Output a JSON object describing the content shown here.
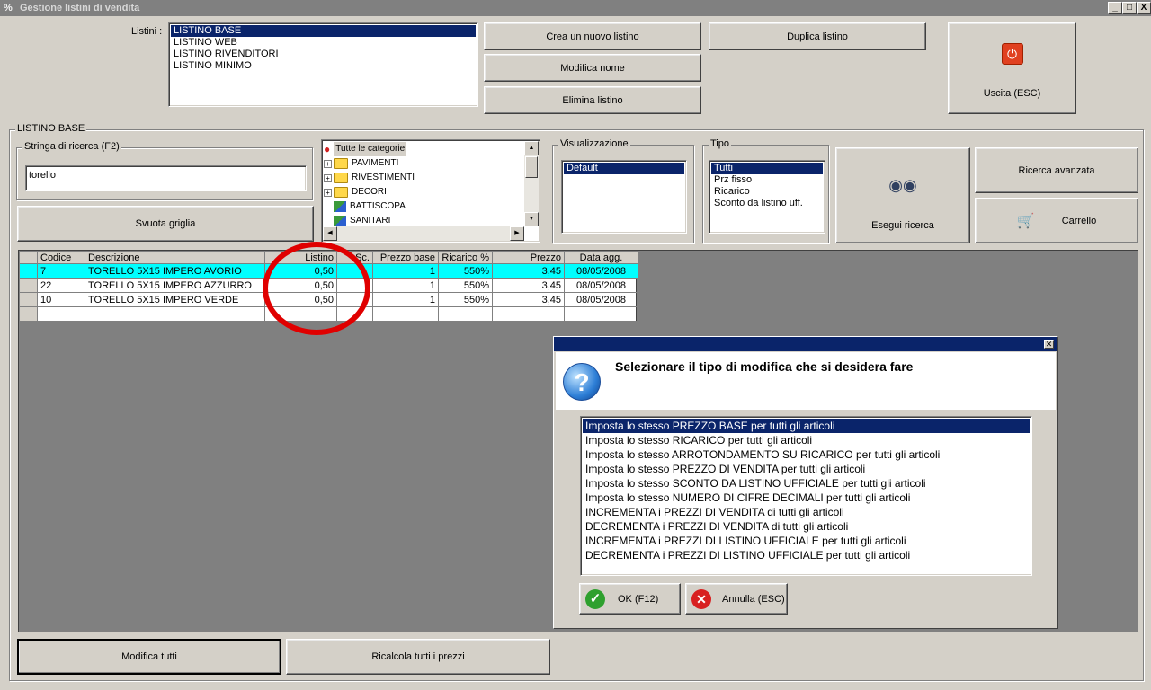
{
  "window": {
    "title": "Gestione listini di vendita",
    "controls": [
      "_",
      "□",
      "X"
    ]
  },
  "listini": {
    "label": "Listini :",
    "items": [
      "LISTINO BASE",
      "LISTINO WEB",
      "LISTINO RIVENDITORI",
      "LISTINO MINIMO"
    ],
    "selected": "LISTINO BASE"
  },
  "buttons": {
    "crea": "Crea un nuovo listino",
    "duplica": "Duplica listino",
    "modifica_nome": "Modifica nome",
    "elimina": "Elimina listino",
    "uscita": "Uscita (ESC)",
    "svuota": "Svuota griglia",
    "esegui": "Esegui ricerca",
    "ricerca_avanzata": "Ricerca avanzata",
    "carrello": "Carrello",
    "modifica_tutti": "Modifica tutti",
    "ricalcola": "Ricalcola tutti i prezzi"
  },
  "section": {
    "title": "LISTINO BASE"
  },
  "search": {
    "label": "Stringa di ricerca (F2)",
    "value": "torello"
  },
  "categories": {
    "root": "Tutte le categorie",
    "items": [
      {
        "name": "PAVIMENTI",
        "type": "folder"
      },
      {
        "name": "RIVESTIMENTI",
        "type": "folder"
      },
      {
        "name": "DECORI",
        "type": "folder"
      },
      {
        "name": "BATTISCOPA",
        "type": "leaf"
      },
      {
        "name": "SANITARI",
        "type": "leaf"
      }
    ]
  },
  "visualizzazione": {
    "label": "Visualizzazione",
    "items": [
      "Default"
    ],
    "selected": "Default"
  },
  "tipo": {
    "label": "Tipo",
    "items": [
      "Tutti",
      "Prz fisso",
      "Ricarico",
      "Sconto da listino uff."
    ],
    "selected": "Tutti"
  },
  "grid": {
    "columns": [
      "Codice",
      "Descrizione",
      "Listino",
      "Sc.",
      "Prezzo base",
      "Ricarico %",
      "Prezzo",
      "Data agg."
    ],
    "rows": [
      {
        "codice": "7",
        "descrizione": "TORELLO 5X15 IMPERO AVORIO",
        "listino": "0,50",
        "sc": "",
        "prezzo_base": "1",
        "ricarico": "550%",
        "prezzo": "3,45",
        "data": "08/05/2008",
        "highlighted": true
      },
      {
        "codice": "22",
        "descrizione": "TORELLO 5X15 IMPERO AZZURRO",
        "listino": "0,50",
        "sc": "",
        "prezzo_base": "1",
        "ricarico": "550%",
        "prezzo": "3,45",
        "data": "08/05/2008",
        "highlighted": false
      },
      {
        "codice": "10",
        "descrizione": "TORELLO 5X15 IMPERO VERDE",
        "listino": "0,50",
        "sc": "",
        "prezzo_base": "1",
        "ricarico": "550%",
        "prezzo": "3,45",
        "data": "08/05/2008",
        "highlighted": false
      }
    ]
  },
  "dialog": {
    "message": "Selezionare il tipo di modifica che si desidera fare",
    "options": [
      "Imposta lo stesso PREZZO BASE per tutti gli articoli",
      "Imposta lo stesso RICARICO per tutti gli articoli",
      "Imposta lo stesso ARROTONDAMENTO SU RICARICO per tutti gli articoli",
      "Imposta lo stesso PREZZO DI VENDITA per tutti gli articoli",
      "Imposta lo stesso SCONTO DA LISTINO UFFICIALE per tutti gli articoli",
      "Imposta lo stesso NUMERO DI CIFRE DECIMALI per tutti gli articoli",
      "INCREMENTA i PREZZI DI VENDITA di tutti gli articoli",
      "DECREMENTA i PREZZI DI VENDITA di tutti gli articoli",
      "INCREMENTA i PREZZI DI LISTINO UFFICIALE per tutti gli articoli",
      "DECREMENTA i PREZZI DI LISTINO UFFICIALE per tutti gli articoli"
    ],
    "selected_index": 0,
    "ok": "OK (F12)",
    "annulla": "Annulla (ESC)"
  },
  "colors": {
    "selection": "#0a246a",
    "highlight_row": "#00ffff",
    "annotation": "#e00000",
    "face": "#d4d0c8",
    "workspace": "#808080"
  }
}
